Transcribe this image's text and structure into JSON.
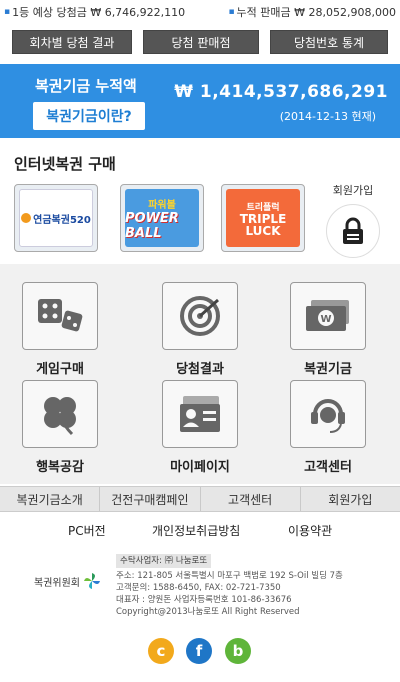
{
  "ticker": {
    "first_prize": "1등 예상 당첨금 ₩ 6,746,922,110",
    "total_sales": "누적 판매금 ₩ 28,052,908,000"
  },
  "top_buttons": [
    "회차별 당첨 결과",
    "당첨 판매점",
    "당첨번호 통계"
  ],
  "fund": {
    "title": "복권기금 누적액",
    "button_label": "복권기금이란?",
    "amount": "₩ 1,414,537,686,291",
    "date": "(2014-12-13 현재)"
  },
  "purchase": {
    "title": "인터넷복권 구매",
    "tiles": [
      {
        "name": "연금복권520",
        "text": "연금복권520"
      },
      {
        "name": "파워볼",
        "top": "파워볼",
        "main": "POWER BALL"
      },
      {
        "name": "트리플럭",
        "top": "트리플럭",
        "main": "TRIPLE LUCK"
      }
    ],
    "join_label": "회원가입"
  },
  "menu": [
    {
      "label": "게임구매",
      "icon": "dice-icon"
    },
    {
      "label": "당첨결과",
      "icon": "target-icon"
    },
    {
      "label": "복권기금",
      "icon": "money-icon"
    },
    {
      "label": "행복공감",
      "icon": "clover-icon"
    },
    {
      "label": "마이페이지",
      "icon": "id-card-icon"
    },
    {
      "label": "고객센터",
      "icon": "headset-icon"
    }
  ],
  "bottom_nav": [
    "복권기금소개",
    "건전구매캠페인",
    "고객센터",
    "회원가입"
  ],
  "links": [
    "PC버전",
    "개인정보취급방침",
    "이용약관"
  ],
  "footer": {
    "org_name": "복권위원회",
    "trustee": "수탁사업자: ㈜ 나눔로또",
    "address": "주소: 121-805 서울특별시 마포구 백범로 192 S-Oil 빌딩 7층",
    "contact": "고객문의: 1588-6450, FAX: 02-721-7350",
    "ceo": "대표자 : 양원돈 사업자등록번호 101-86-33676",
    "copyright": "Copyright@2013나눔로또 All Right Reserved"
  },
  "social": [
    "c",
    "f",
    "b"
  ],
  "colors": {
    "accent_blue": "#2f8fe2",
    "dark_button": "#555555",
    "grid_bg": "#f1f1f1"
  }
}
